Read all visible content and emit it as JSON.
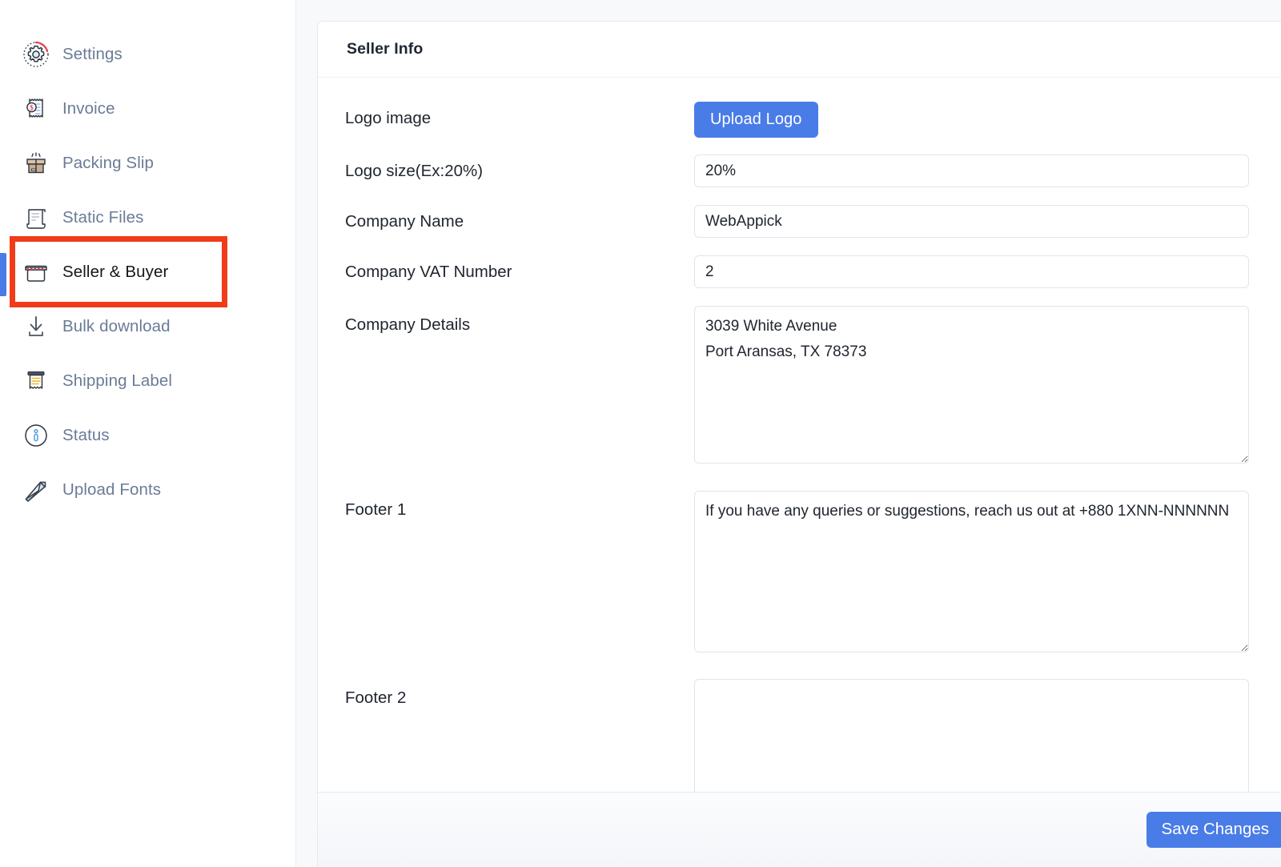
{
  "sidebar": {
    "items": [
      {
        "label": "Settings",
        "icon": "gear-icon",
        "active": false
      },
      {
        "label": "Invoice",
        "icon": "invoice-icon",
        "active": false
      },
      {
        "label": "Packing Slip",
        "icon": "open-box-icon",
        "active": false
      },
      {
        "label": "Static Files",
        "icon": "scroll-document-icon",
        "active": false
      },
      {
        "label": "Seller & Buyer",
        "icon": "storefront-icon",
        "active": true
      },
      {
        "label": "Bulk download",
        "icon": "download-arrow-icon",
        "active": false
      },
      {
        "label": "Shipping Label",
        "icon": "shipping-label-icon",
        "active": false
      },
      {
        "label": "Status",
        "icon": "info-circle-icon",
        "active": false
      },
      {
        "label": "Upload Fonts",
        "icon": "pen-nib-icon",
        "active": false
      }
    ]
  },
  "card": {
    "title": "Seller Info",
    "rows": {
      "logo_image": {
        "label": "Logo image",
        "button_label": "Upload Logo"
      },
      "logo_size": {
        "label": "Logo size(Ex:20%)",
        "value": "20%",
        "placeholder": ""
      },
      "company_name": {
        "label": "Company Name",
        "value": "WebAppick",
        "placeholder": ""
      },
      "company_vat": {
        "label": "Company VAT Number",
        "value": "2",
        "placeholder": ""
      },
      "company_details": {
        "label": "Company Details",
        "value": "3039 White Avenue\nPort Aransas, TX 78373",
        "placeholder": ""
      },
      "footer1": {
        "label": "Footer 1",
        "value": "If you have any queries or suggestions, reach us out at +880 1XNN-NNNNNN",
        "placeholder": ""
      },
      "footer2": {
        "label": "Footer 2",
        "value": "",
        "placeholder": ""
      }
    },
    "footer": {
      "save_label": "Save Changes"
    }
  },
  "annotation": {
    "highlight_color": "#f03c19",
    "target": "Seller & Buyer"
  },
  "colors": {
    "accent_blue": "#4a7ce8",
    "sidebar_label": "#6b7b96",
    "active_label": "#13161b",
    "page_bg": "#f7f9fb"
  }
}
